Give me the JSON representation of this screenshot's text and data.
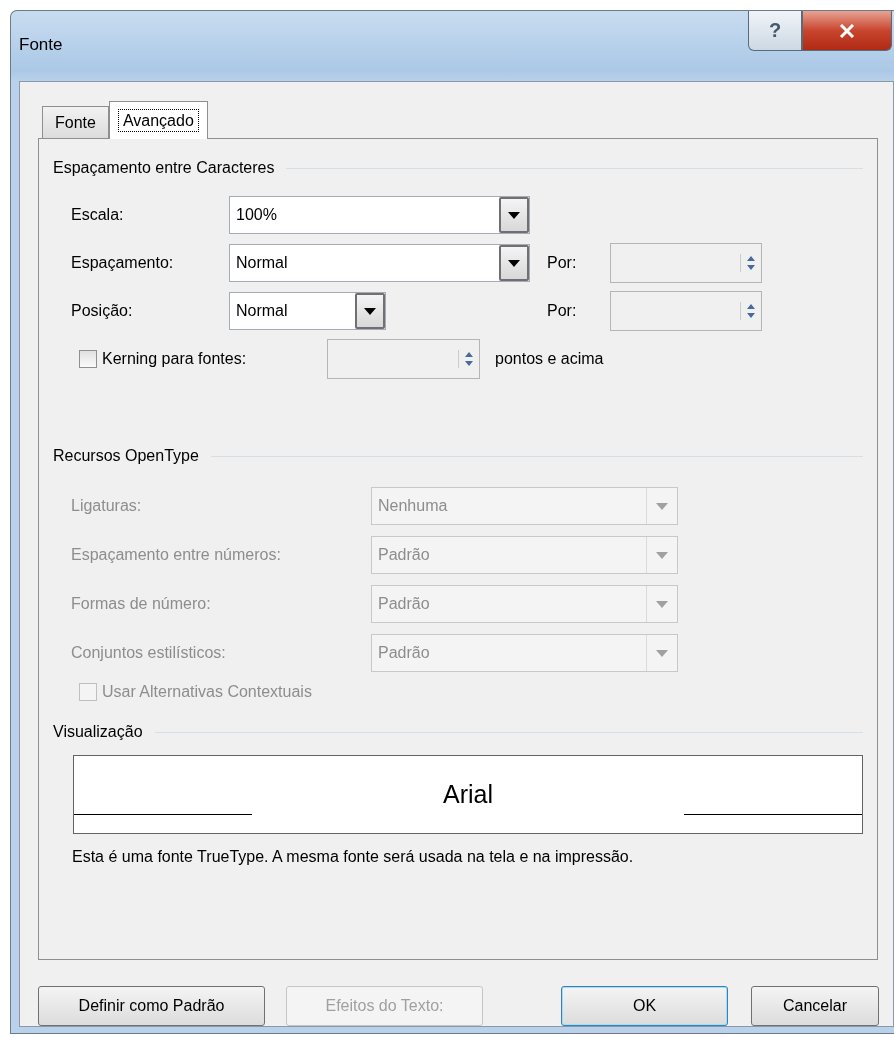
{
  "window": {
    "title": "Fonte",
    "help": "?"
  },
  "tabs": [
    {
      "label": "Fonte",
      "selected": false
    },
    {
      "label": "Avançado",
      "selected": true
    }
  ],
  "character_spacing": {
    "title": "Espaçamento entre Caracteres",
    "rows": [
      {
        "label": "Escala:",
        "value": "100%",
        "kind": "wide"
      },
      {
        "label": "Espaçamento:",
        "value": "Normal",
        "kind": "wide",
        "by_label": "Por:"
      },
      {
        "label": "Posição:",
        "value": "Normal",
        "kind": "narrow",
        "by_label": "Por:"
      }
    ],
    "kerning": {
      "label": "Kerning para fontes:",
      "checked": false,
      "suffix": "pontos e acima"
    }
  },
  "opentype": {
    "title": "Recursos OpenType",
    "disabled": true,
    "rows": [
      {
        "label": "Ligaturas:",
        "value": "Nenhuma"
      },
      {
        "label": "Espaçamento entre números:",
        "value": "Padrão"
      },
      {
        "label": "Formas de número:",
        "value": "Padrão"
      },
      {
        "label": "Conjuntos estilísticos:",
        "value": "Padrão"
      }
    ],
    "contextual": {
      "label": "Usar Alternativas Contextuais",
      "checked": false
    }
  },
  "preview": {
    "title": "Visualização",
    "sample": "Arial",
    "note": "Esta é uma fonte TrueType. A mesma fonte será usada na tela e na impressão."
  },
  "buttons": [
    {
      "label": "Definir como Padrão",
      "disabled": false,
      "default": false
    },
    {
      "label": "Efeitos do Texto:",
      "disabled": true,
      "default": false
    },
    {
      "label": "OK",
      "disabled": false,
      "default": true
    },
    {
      "label": "Cancelar",
      "disabled": false,
      "default": false
    }
  ]
}
